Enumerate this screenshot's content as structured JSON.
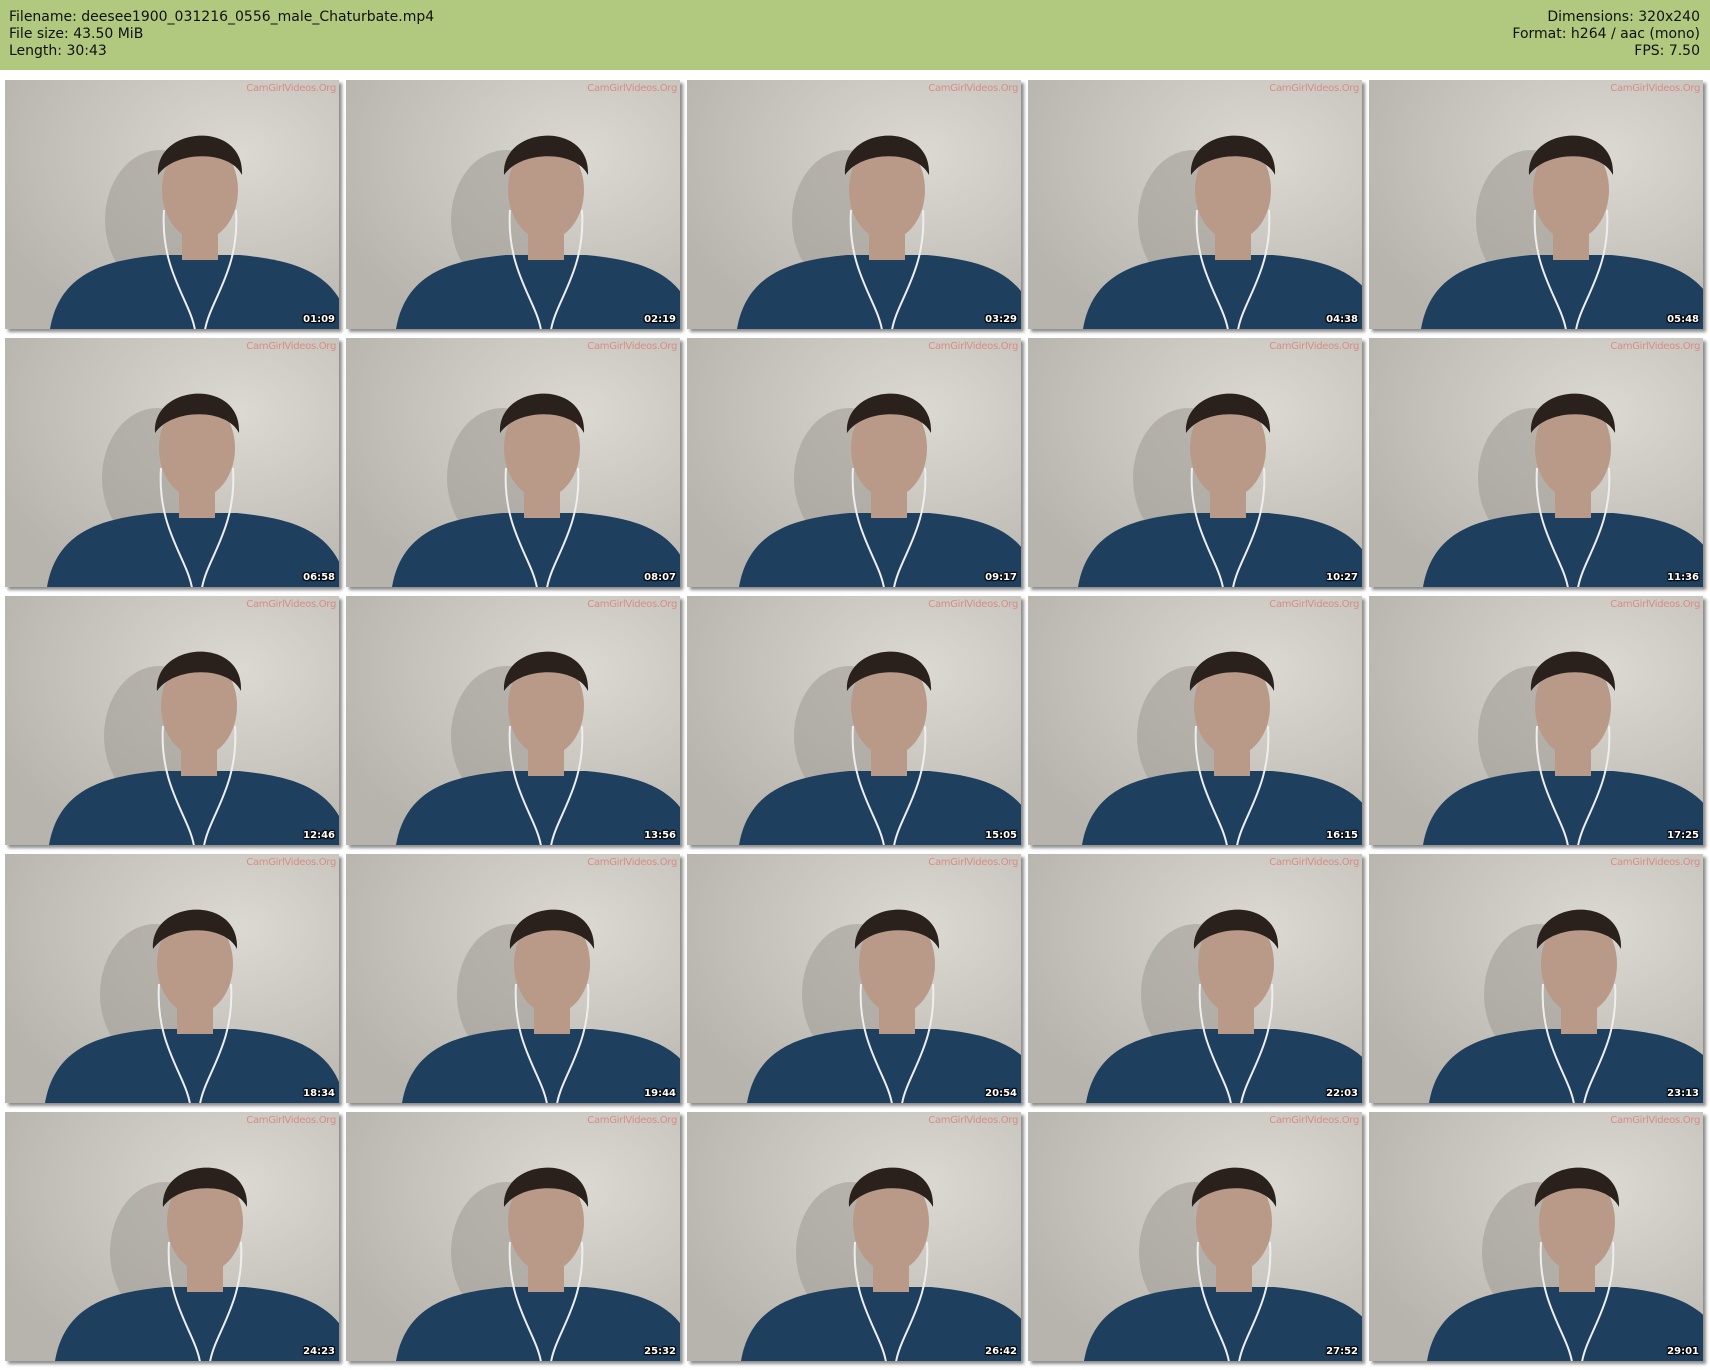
{
  "header": {
    "left": [
      "Filename: deesee1900_031216_0556_male_Chaturbate.mp4",
      "File size: 43.50 MiB",
      "Length: 30:43"
    ],
    "right": [
      "Dimensions: 320x240",
      "Format: h264 / aac (mono)",
      "FPS: 7.50"
    ]
  },
  "colors": {
    "header_bg": "#b0c97f",
    "wall": "#cfcbc4",
    "shirt": "#1f3f5e",
    "hair": "#2a211c",
    "skin": "#b99a88"
  },
  "watermark": "CamGirlVideos.Org",
  "thumbnails": [
    {
      "timestamp": "01:09"
    },
    {
      "timestamp": "02:19"
    },
    {
      "timestamp": "03:29"
    },
    {
      "timestamp": "04:38"
    },
    {
      "timestamp": "05:48"
    },
    {
      "timestamp": "06:58"
    },
    {
      "timestamp": "08:07"
    },
    {
      "timestamp": "09:17"
    },
    {
      "timestamp": "10:27"
    },
    {
      "timestamp": "11:36"
    },
    {
      "timestamp": "12:46"
    },
    {
      "timestamp": "13:56"
    },
    {
      "timestamp": "15:05"
    },
    {
      "timestamp": "16:15"
    },
    {
      "timestamp": "17:25"
    },
    {
      "timestamp": "18:34"
    },
    {
      "timestamp": "19:44"
    },
    {
      "timestamp": "20:54"
    },
    {
      "timestamp": "22:03"
    },
    {
      "timestamp": "23:13"
    },
    {
      "timestamp": "24:23"
    },
    {
      "timestamp": "25:32"
    },
    {
      "timestamp": "26:42"
    },
    {
      "timestamp": "27:52"
    },
    {
      "timestamp": "29:01"
    }
  ]
}
